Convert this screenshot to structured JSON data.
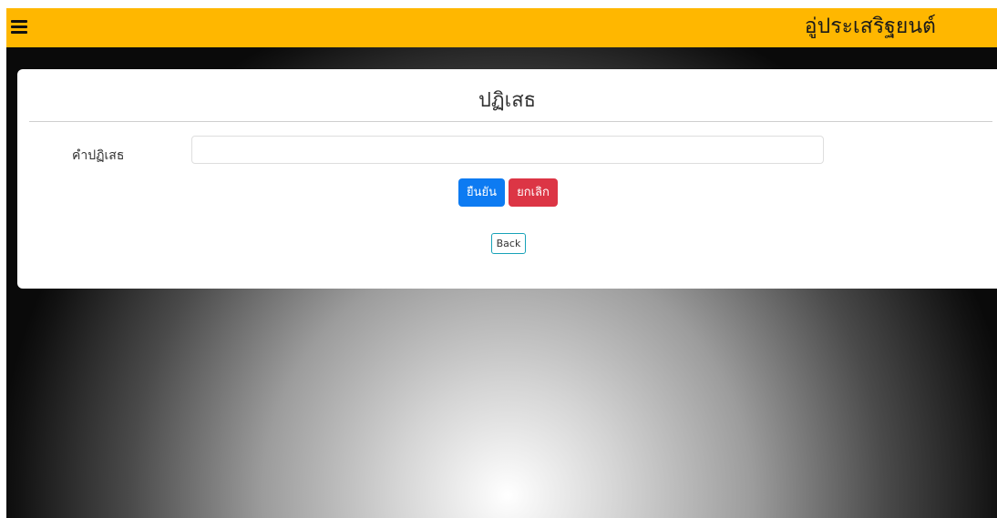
{
  "header": {
    "brand": "อู่ประเสริฐยนต์",
    "menu_icon": "hamburger-menu-icon",
    "background_color": "#ffb700"
  },
  "form": {
    "title": "ปฏิเสธ",
    "reason_label": "คำปฏิเสธ",
    "reason_value": "",
    "reason_placeholder": "",
    "confirm_label": "ยืนยัน",
    "cancel_label": "ยกเลิก",
    "back_label": "Back"
  },
  "colors": {
    "confirm_button": "#0d7bf2",
    "cancel_button": "#dc3545",
    "back_button_border": "#17a2b8"
  }
}
